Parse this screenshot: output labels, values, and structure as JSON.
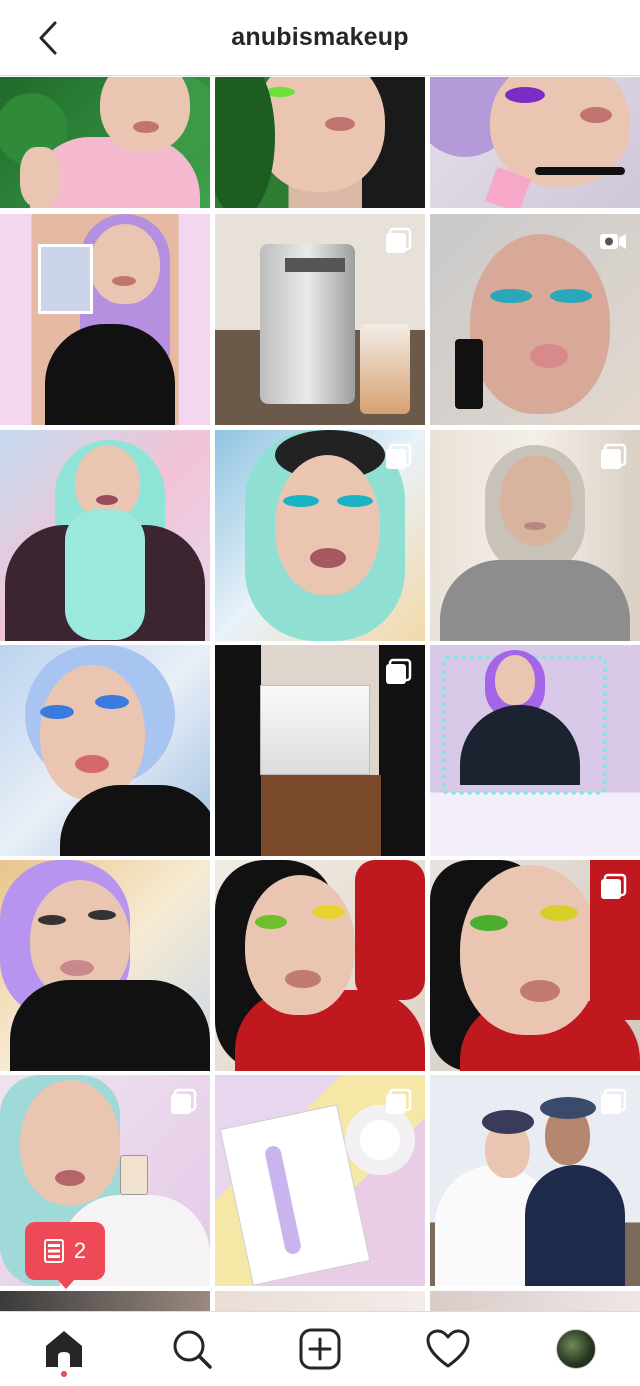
{
  "header": {
    "title": "anubismakeup",
    "back_icon": "chevron-left-icon"
  },
  "posts": [
    {
      "id": "p1",
      "type": "image",
      "theme": "st-patricks-portrait"
    },
    {
      "id": "p2",
      "type": "image",
      "theme": "green-hair-portrait"
    },
    {
      "id": "p3",
      "type": "image",
      "theme": "purple-eyeshadow-portrait"
    },
    {
      "id": "p4",
      "type": "image",
      "theme": "lavender-hair-product"
    },
    {
      "id": "p5",
      "type": "carousel",
      "theme": "keurig-coffee-maker"
    },
    {
      "id": "p6",
      "type": "video",
      "theme": "teal-liner-closeup"
    },
    {
      "id": "p7",
      "type": "image",
      "theme": "mint-hair-selfie"
    },
    {
      "id": "p8",
      "type": "carousel",
      "theme": "mint-hair-closeup"
    },
    {
      "id": "p9",
      "type": "carousel",
      "theme": "bare-face"
    },
    {
      "id": "p10",
      "type": "image",
      "theme": "blue-hair-portrait"
    },
    {
      "id": "p11",
      "type": "carousel",
      "theme": "box-on-floor"
    },
    {
      "id": "p12",
      "type": "image",
      "theme": "purple-hair-mirror"
    },
    {
      "id": "p13",
      "type": "image",
      "theme": "purple-hair-smile"
    },
    {
      "id": "p14",
      "type": "image",
      "theme": "green-eyeshadow-red-top"
    },
    {
      "id": "p15",
      "type": "carousel",
      "theme": "green-eyeshadow-closeup"
    },
    {
      "id": "p16",
      "type": "carousel",
      "theme": "perfume-portrait"
    },
    {
      "id": "p17",
      "type": "carousel",
      "theme": "razor-flatlay"
    },
    {
      "id": "p18",
      "type": "carousel",
      "theme": "couple-photo"
    }
  ],
  "notification": {
    "count": "2",
    "icon": "activity-feed-icon",
    "color": "#ED4956"
  },
  "tabbar": {
    "items": [
      {
        "name": "home",
        "icon": "home-icon",
        "active": true
      },
      {
        "name": "search",
        "icon": "search-icon",
        "active": false
      },
      {
        "name": "new-post",
        "icon": "plus-square-icon",
        "active": false
      },
      {
        "name": "activity",
        "icon": "heart-icon",
        "active": false
      },
      {
        "name": "profile",
        "icon": "profile-avatar-icon",
        "active": false
      }
    ]
  },
  "colors": {
    "accent": "#ED4956",
    "text": "#262626",
    "divider": "#DBDBDB"
  }
}
